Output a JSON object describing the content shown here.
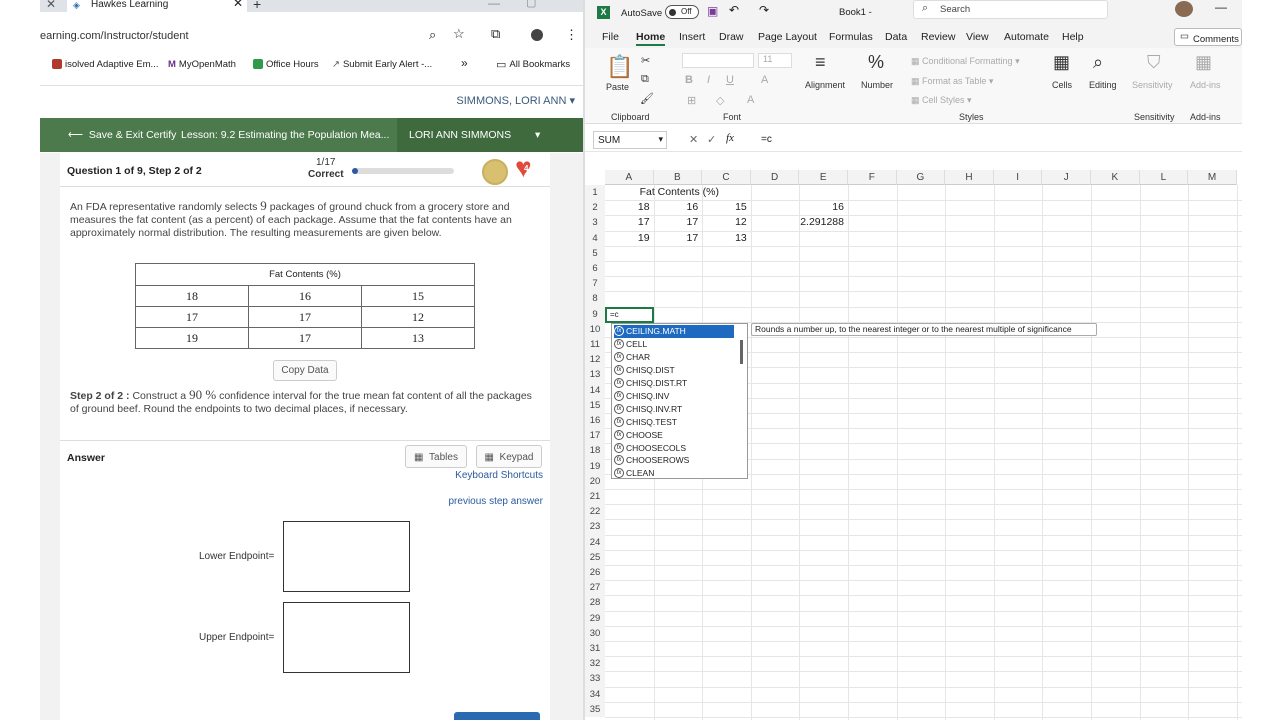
{
  "browser": {
    "tab_title": "Hawkes Learning",
    "url": "earning.com/Instructor/student",
    "bookmarks": [
      "isolved Adaptive Em...",
      "MyOpenMath",
      "Office Hours",
      "Submit Early Alert -...",
      "All Bookmarks"
    ],
    "user_name": "SIMMONS, LORI ANN",
    "save_exit": "Save & Exit Certify",
    "lesson": "Lesson: 9.2 Estimating the Population Mea...",
    "student": "LORI ANN SIMMONS",
    "question_label": "Question 1 of 9, Step 2 of 2",
    "progress_count": "1/17",
    "progress_status": "Correct",
    "progress_fraction": 0.06,
    "hearts": "4",
    "question_text_a": "An FDA representative randomly selects",
    "question_n": "9",
    "question_text_b": "packages of ground chuck from a grocery store and measures the fat content (as a percent) of each package. Assume that the fat contents have an approximately normal distribution. The resulting measurements are given below.",
    "table_title": "Fat Contents (%)",
    "table_rows": [
      [
        "18",
        "16",
        "15"
      ],
      [
        "17",
        "17",
        "12"
      ],
      [
        "19",
        "17",
        "13"
      ]
    ],
    "copy_data": "Copy Data",
    "step_label": "Step 2 of 2 :",
    "step_text_a": "Construct a",
    "step_conf": "90 %",
    "step_text_b": "confidence interval for the true mean fat content of all the packages of ground beef. Round the endpoints to two decimal places, if necessary.",
    "answer_label": "Answer",
    "tables_btn": "Tables",
    "keypad_btn": "Keypad",
    "keyboard_shortcuts": "Keyboard Shortcuts",
    "previous_step": "previous step answer",
    "lower_label": "Lower Endpoint=",
    "upper_label": "Upper Endpoint="
  },
  "excel": {
    "autosave": "AutoSave",
    "autosave_state": "Off",
    "book": "Book1  -",
    "search": "Search",
    "menu": [
      "File",
      "Home",
      "Insert",
      "Draw",
      "Page Layout",
      "Formulas",
      "Data",
      "Review",
      "View",
      "Automate",
      "Help"
    ],
    "comments": "Comments",
    "ribbon": {
      "paste": "Paste",
      "clipboard": "Clipboard",
      "font": "Font",
      "font_size": "11",
      "alignment": "Alignment",
      "number": "Number",
      "cond_fmt": "Conditional Formatting",
      "fmt_table": "Format as Table",
      "cell_styles": "Cell Styles",
      "styles": "Styles",
      "cells": "Cells",
      "editing": "Editing",
      "sensitivity": "Sensitivity",
      "addins": "Add-ins"
    },
    "name_box": "SUM",
    "formula": "=c",
    "columns": [
      "A",
      "B",
      "C",
      "D",
      "E",
      "F",
      "G",
      "H",
      "I",
      "J",
      "K",
      "L",
      "M"
    ],
    "cells": {
      "title": "Fat Contents (%)",
      "r2": [
        "18",
        "16",
        "15"
      ],
      "r3": [
        "17",
        "17",
        "12"
      ],
      "r4": [
        "19",
        "17",
        "13"
      ],
      "e2": "16",
      "e3": "2.291288",
      "a9": "=c"
    },
    "autocomplete": [
      "CEILING.MATH",
      "CELL",
      "CHAR",
      "CHISQ.DIST",
      "CHISQ.DIST.RT",
      "CHISQ.INV",
      "CHISQ.INV.RT",
      "CHISQ.TEST",
      "CHOOSE",
      "CHOOSECOLS",
      "CHOOSEROWS",
      "CLEAN"
    ],
    "tooltip": "Rounds a number up, to the nearest integer or to the nearest multiple of significance"
  }
}
